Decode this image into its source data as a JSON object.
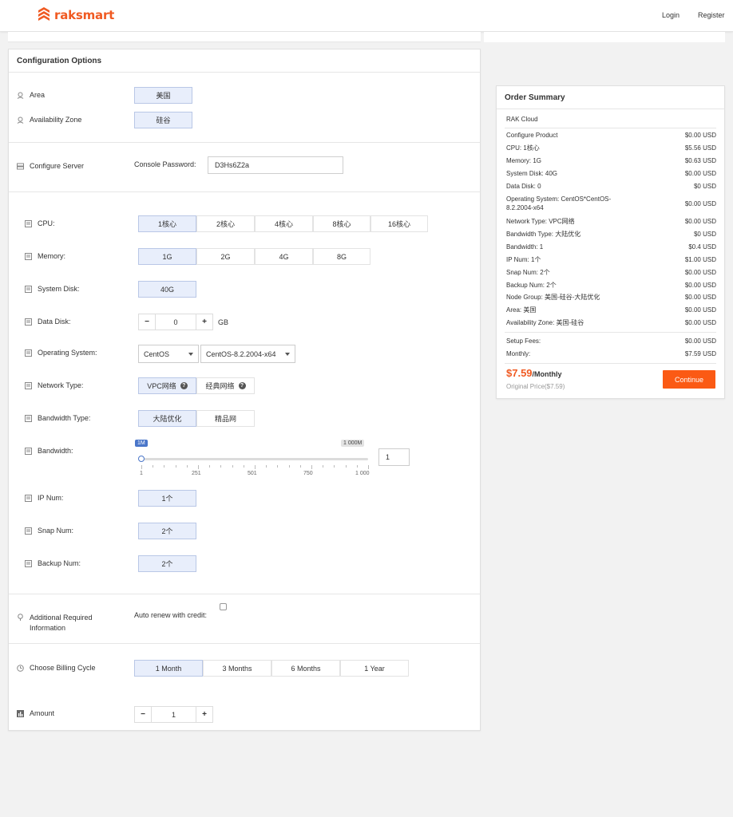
{
  "colors": {
    "accent": "#f05a22",
    "selected_bg": "#e8eefb",
    "continue_bg": "#fb5a14",
    "slider_blue": "#4a76c9"
  },
  "header": {
    "logo_text": "raksmart",
    "login": "Login",
    "register": "Register"
  },
  "config": {
    "title": "Configuration Options",
    "area": {
      "label": "Area",
      "value": "美国",
      "icon": "location-pin-icon"
    },
    "zone": {
      "label": "Availability Zone",
      "value": "硅谷",
      "icon": "location-pin-icon"
    },
    "server": {
      "label": "Configure Server",
      "icon": "server-icon",
      "password_label": "Console Password:",
      "password_value": "D3Hs6Z2a"
    },
    "cpu": {
      "label": "CPU:",
      "options": [
        "1核心",
        "2核心",
        "4核心",
        "8核心",
        "16核心"
      ],
      "selected": "1核心"
    },
    "memory": {
      "label": "Memory:",
      "options": [
        "1G",
        "2G",
        "4G",
        "8G"
      ],
      "selected": "1G"
    },
    "system_disk": {
      "label": "System Disk:",
      "value": "40G"
    },
    "data_disk": {
      "label": "Data Disk:",
      "minus": "−",
      "plus": "+",
      "value": "0",
      "unit": "GB"
    },
    "os": {
      "label": "Operating System:",
      "family": "CentOS",
      "version": "CentOS-8.2.2004-x64"
    },
    "network": {
      "label": "Network Type:",
      "options": [
        "VPC网络",
        "经典网络"
      ],
      "selected": "VPC网络"
    },
    "bandwidth_type": {
      "label": "Bandwidth Type:",
      "options": [
        "大陆优化",
        "精品网"
      ],
      "selected": "大陆优化"
    },
    "bandwidth": {
      "label": "Bandwidth:",
      "min_tag": "1M",
      "max_tag": "1 000M",
      "ticks": [
        "1",
        "251",
        "501",
        "750",
        "1 000"
      ],
      "value": "1"
    },
    "ip_num": {
      "label": "IP Num:",
      "value": "1个"
    },
    "snap_num": {
      "label": "Snap Num:",
      "value": "2个"
    },
    "backup_num": {
      "label": "Backup Num:",
      "value": "2个"
    },
    "additional": {
      "label_line1": "Additional Required",
      "label_line2": "Information",
      "auto_renew": "Auto renew with credit:"
    },
    "billing": {
      "label": "Choose Billing Cycle",
      "options": [
        "1 Month",
        "3 Months",
        "6 Months",
        "1 Year"
      ],
      "selected": "1 Month"
    },
    "amount": {
      "label": "Amount",
      "minus": "−",
      "plus": "+",
      "value": "1"
    }
  },
  "summary": {
    "title": "Order Summary",
    "product": "RAK Cloud",
    "items": [
      {
        "k": "Configure Product",
        "v": "$0.00 USD"
      },
      {
        "k": "CPU: 1核心",
        "v": "$5.56 USD"
      },
      {
        "k": "Memory: 1G",
        "v": "$0.63 USD"
      },
      {
        "k": "System Disk: 40G",
        "v": "$0.00 USD"
      },
      {
        "k": "Data Disk: 0",
        "v": "$0 USD"
      },
      {
        "k": "Operating System: CentOS*CentOS-8.2.2004-x64",
        "v": "$0.00 USD"
      },
      {
        "k": "Network Type: VPC网络",
        "v": "$0.00 USD"
      },
      {
        "k": "Bandwidth Type: 大陆优化",
        "v": "$0 USD"
      },
      {
        "k": "Bandwidth: 1",
        "v": "$0.4 USD"
      },
      {
        "k": "IP Num: 1个",
        "v": "$1.00 USD"
      },
      {
        "k": "Snap Num: 2个",
        "v": "$0.00 USD"
      },
      {
        "k": "Backup Num: 2个",
        "v": "$0.00 USD"
      },
      {
        "k": "Node Group: 美国-硅谷-大陆优化",
        "v": "$0.00 USD"
      },
      {
        "k": "Area: 美国",
        "v": "$0.00 USD"
      },
      {
        "k": "Availability Zone: 美国-硅谷",
        "v": "$0.00 USD"
      }
    ],
    "setup_label": "Setup Fees:",
    "setup_value": "$0.00 USD",
    "monthly_label": "Monthly:",
    "monthly_value": "$7.59 USD",
    "price": "$7.59",
    "price_unit": "/Monthly",
    "original": "Original Price($7.59)",
    "continue": "Continue"
  }
}
